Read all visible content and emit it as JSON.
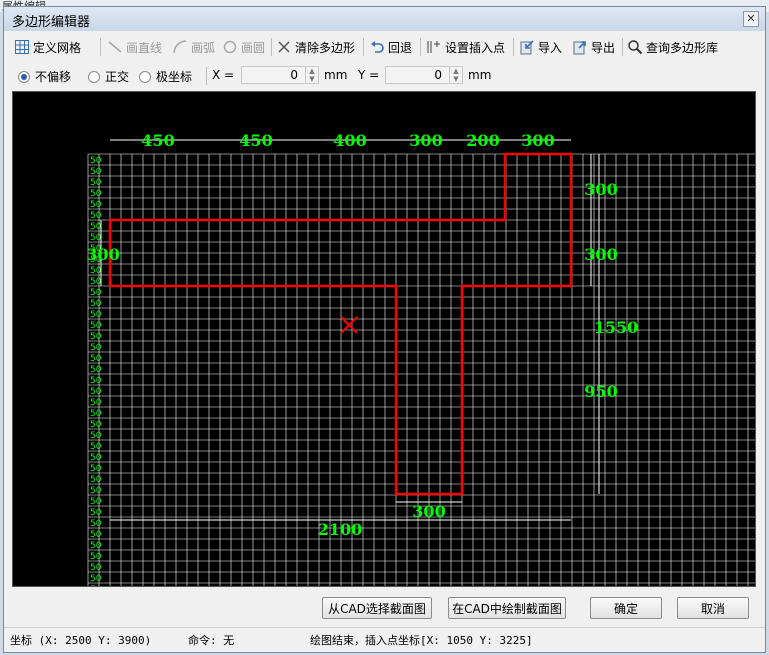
{
  "window": {
    "title": "多边形编辑器",
    "close_glyph": "✕",
    "bg_text": "属性编辑"
  },
  "toolbar": {
    "define_grid": "定义网格",
    "draw_line": "画直线",
    "draw_arc": "画弧",
    "draw_circle": "画圆",
    "clear_polygon": "清除多边形",
    "undo": "回退",
    "set_insert_point": "设置插入点",
    "import": "导入",
    "export": "导出",
    "query_library": "查询多边形库"
  },
  "options": {
    "no_offset": "不偏移",
    "ortho": "正交",
    "polar": "极坐标",
    "selected": "no_offset",
    "x_label": "X =",
    "x_value": "0",
    "x_unit": "mm",
    "y_label": "Y =",
    "y_value": "0",
    "y_unit": "mm"
  },
  "drawing": {
    "top_dims": [
      "450",
      "450",
      "400",
      "300",
      "200",
      "300"
    ],
    "right_dims": [
      "300",
      "300",
      "1550",
      "950"
    ],
    "left_dim": "300",
    "bottom_inner_dim": "300",
    "bottom_total_dim": "2100",
    "row_label": "50",
    "row_count": 43,
    "grid_color": "#ffffff",
    "outline_color": "#ff0000",
    "dim_text_color": "#00ff00",
    "insert_marker_color": "#ff0000"
  },
  "buttons": {
    "select_from_cad": "从CAD选择截面图",
    "draw_in_cad": "在CAD中绘制截面图",
    "ok": "确定",
    "cancel": "取消"
  },
  "status": {
    "coords": "坐标 (X: 2500 Y: 3900)",
    "command": "命令: 无",
    "message": "绘图结束，插入点坐标[X: 1050 Y: 3225]"
  }
}
